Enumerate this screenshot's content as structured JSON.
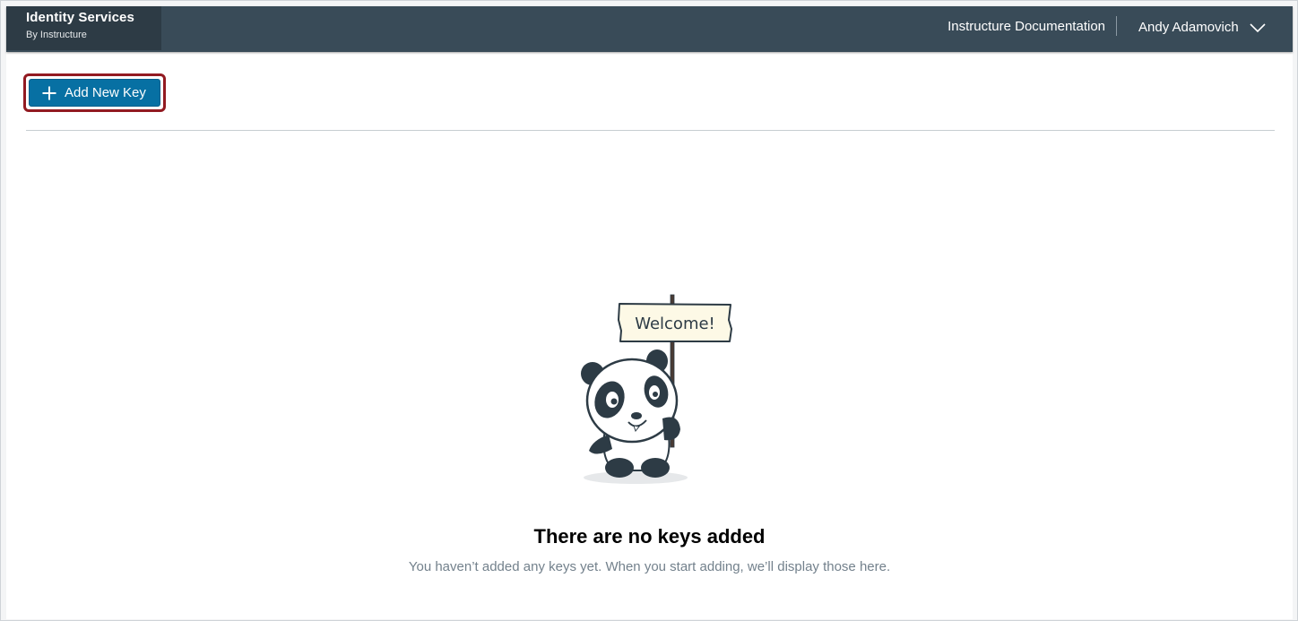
{
  "header": {
    "brand_title": "Identity Services",
    "brand_subtitle": "By Instructure",
    "doc_link": "Instructure Documentation",
    "user_name": "Andy Adamovich",
    "user_menu_icon": "chevron-down-icon"
  },
  "toolbar": {
    "add_key_label": "Add New Key",
    "add_key_icon": "plus-icon"
  },
  "empty_state": {
    "sign_text": "Welcome!",
    "title": "There are no keys added",
    "description": "You haven’t added any keys yet. When you start adding, we’ll display those here."
  },
  "colors": {
    "topbar": "#394b58",
    "brand_panel": "#2d3b45",
    "primary_button": "#0770a3",
    "highlight_outline": "#921a21",
    "muted_text": "#73818c"
  }
}
